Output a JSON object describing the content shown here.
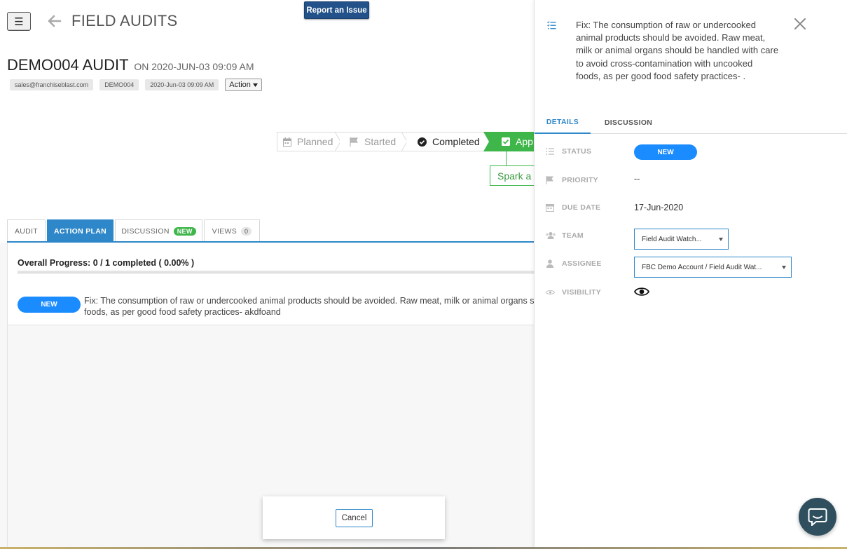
{
  "header": {
    "menu_glyph": "☰",
    "page_title": "FIELD AUDITS",
    "report_issue_label": "Report an Issue"
  },
  "audit": {
    "title": "DEMO004 AUDIT",
    "on_text": "ON 2020-JUN-03 09:09 AM",
    "tags": [
      "sales@franchiseblast.com",
      "DEMO004",
      "2020-Jun-03 09:09 AM"
    ],
    "action_label": "Action"
  },
  "workflow": {
    "steps": [
      "Planned",
      "Started",
      "Completed",
      "App"
    ],
    "spark_label": "Spark a D"
  },
  "tabs": {
    "audit": "AUDIT",
    "action_plan": "ACTION PLAN",
    "discussion": "DISCUSSION",
    "discussion_badge": "NEW",
    "views": "VIEWS",
    "views_count": "0"
  },
  "action_plan": {
    "progress_label": "Overall Progress: 0 / 1 completed ( 0.00% )",
    "progress_fraction": 0.0,
    "items": [
      {
        "status": "NEW",
        "line1": "Fix: The consumption of raw or undercooked animal products should be avoided. Raw meat, milk or animal organs sho",
        "line2": "foods, as per good food safety practices- akdfoand"
      }
    ],
    "cancel_label": "Cancel"
  },
  "detail": {
    "title": "Fix: The consumption of raw or undercooked animal products should be avoided. Raw meat, milk or animal organs should be handled with care to avoid cross-contamination with uncooked foods, as per good food safety practices- .",
    "tab_details": "DETAILS",
    "tab_discussion": "DISCUSSION",
    "fields": {
      "status_label": "STATUS",
      "status_value": "NEW",
      "priority_label": "PRIORITY",
      "priority_value": "--",
      "due_date_label": "DUE DATE",
      "due_date_value": "17-Jun-2020",
      "team_label": "TEAM",
      "team_value": "Field Audit Watch...",
      "assignee_label": "ASSIGNEE",
      "assignee_value": "FBC Demo Account / Field Audit Wat...",
      "visibility_label": "VISIBILITY"
    }
  },
  "colors": {
    "accent_blue": "#2e87c8",
    "status_blue": "#1a8cff",
    "approved_green": "#3fb64a",
    "report_navy": "#23528a",
    "chat_dark": "#2f4f5f"
  }
}
